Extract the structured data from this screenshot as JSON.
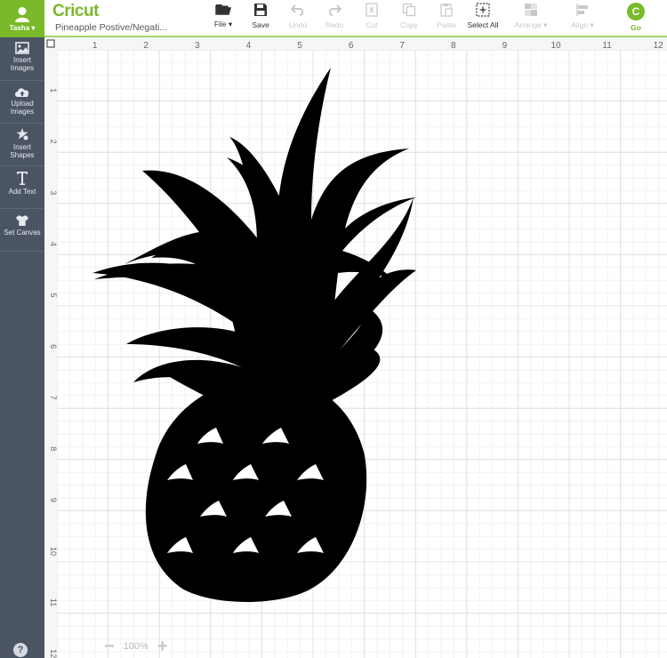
{
  "user": {
    "name": "Tasha ▾"
  },
  "sidebar": {
    "items": [
      {
        "label": "Insert Images",
        "icon": "image-icon"
      },
      {
        "label": "Upload Images",
        "icon": "cloud-upload-icon"
      },
      {
        "label": "Insert Shapes",
        "icon": "shapes-icon"
      },
      {
        "label": "Add Text",
        "icon": "text-icon"
      },
      {
        "label": "Set Canvas",
        "icon": "tshirt-icon"
      }
    ],
    "help": "?"
  },
  "header": {
    "logo": "Cricut",
    "project_name": "Pineapple Postive/Negati...",
    "file_label": "File ▾",
    "save_label": "Save",
    "undo_label": "Undo",
    "redo_label": "Redo",
    "cut_label": "Cut",
    "copy_label": "Copy",
    "paste_label": "Paste",
    "select_all_label": "Select All",
    "arrange_label": "Arrange ▾",
    "align_label": "Align ▾",
    "go_label": "Go",
    "go_glyph": "C"
  },
  "canvas": {
    "ruler_top": [
      "1",
      "2",
      "3",
      "4",
      "5",
      "6",
      "7",
      "8",
      "9",
      "10",
      "11",
      "12"
    ],
    "ruler_left": [
      "1",
      "2",
      "3",
      "4",
      "5",
      "6",
      "7",
      "8",
      "9",
      "10",
      "11",
      "12"
    ]
  },
  "zoom": {
    "minus": "−",
    "level": "100%",
    "plus": "+"
  },
  "colors": {
    "accent": "#79b92a",
    "sidebar": "#4a5463",
    "grid_major": "#dfe3e7",
    "grid_minor": "#f1f3f5",
    "shape": "#000000"
  }
}
